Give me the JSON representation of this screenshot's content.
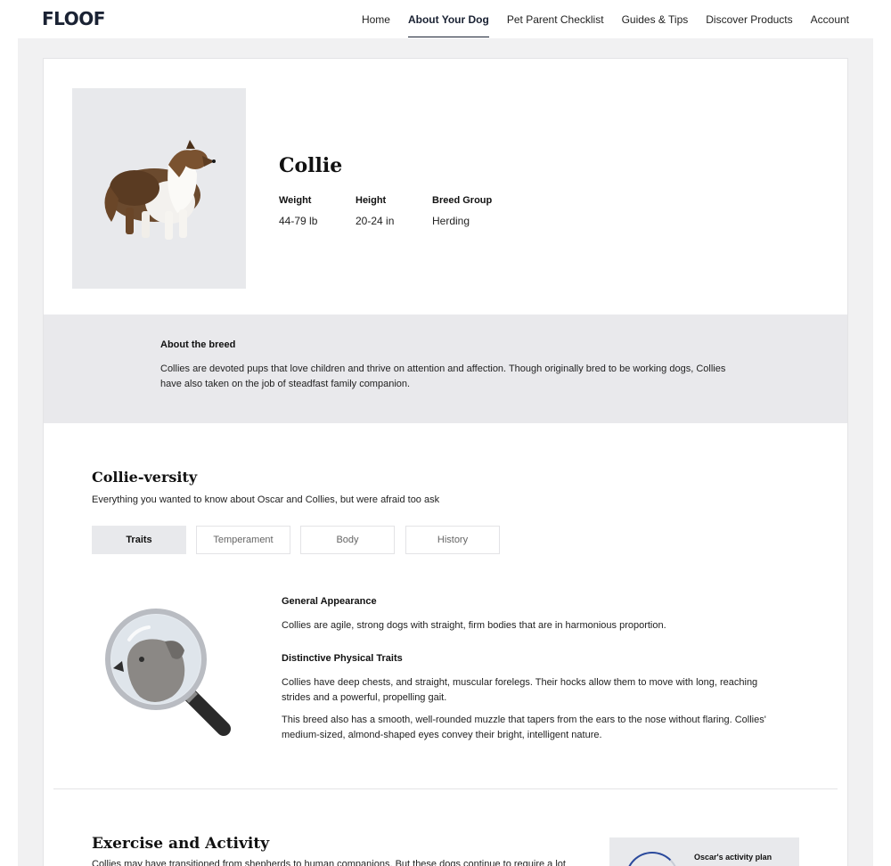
{
  "header": {
    "logo": "FLOOF",
    "nav": [
      {
        "label": "Home",
        "active": false
      },
      {
        "label": "About Your Dog",
        "active": true
      },
      {
        "label": "Pet Parent Checklist",
        "active": false
      },
      {
        "label": "Guides & Tips",
        "active": false
      },
      {
        "label": "Discover Products",
        "active": false
      },
      {
        "label": "Account",
        "active": false
      }
    ]
  },
  "breed": {
    "name": "Collie",
    "image": "collie-dog-photo",
    "stats": [
      {
        "label": "Weight",
        "value": "44-79 lb"
      },
      {
        "label": "Height",
        "value": "20-24 in"
      },
      {
        "label": "Breed Group",
        "value": "Herding"
      }
    ]
  },
  "about": {
    "title": "About the breed",
    "text": "Collies are devoted pups that love children and thrive on attention and affection. Though originally bred to be working dogs, Collies have also taken on the job of steadfast family companion."
  },
  "versity": {
    "title": "Collie-versity",
    "subtitle": "Everything you wanted to know about Oscar and Collies, but were afraid too ask",
    "tabs": [
      {
        "label": "Traits",
        "active": true
      },
      {
        "label": "Temperament",
        "active": false
      },
      {
        "label": "Body",
        "active": false
      },
      {
        "label": "History",
        "active": false
      }
    ],
    "icon": "magnifying-glass-dog-icon",
    "sections": [
      {
        "heading": "General Appearance",
        "paragraphs": [
          "Collies are agile, strong dogs with straight, firm bodies that are in harmonious proportion."
        ]
      },
      {
        "heading": "Distinctive Physical Traits",
        "paragraphs": [
          "Collies have deep chests, and straight, muscular forelegs. Their hocks allow them to move with long, reaching strides and a powerful, propelling gait.",
          "This breed also has a smooth, well-rounded muzzle that tapers from the ears to the nose without flaring. Collies' medium-sized, almond-shaped eyes convey their bright, intelligent nature."
        ]
      }
    ]
  },
  "exercise": {
    "title": "Exercise and Activity",
    "text": "Collies may have transitioned from shepherds to human companions. But these dogs continue to require a lot of",
    "plan_title": "Oscar's activity plan"
  },
  "colors": {
    "navy": "#1a2233",
    "panel_gray": "#e8e9ec",
    "page_bg": "#f1f1f2",
    "accent_blue": "#2b4a9c"
  }
}
